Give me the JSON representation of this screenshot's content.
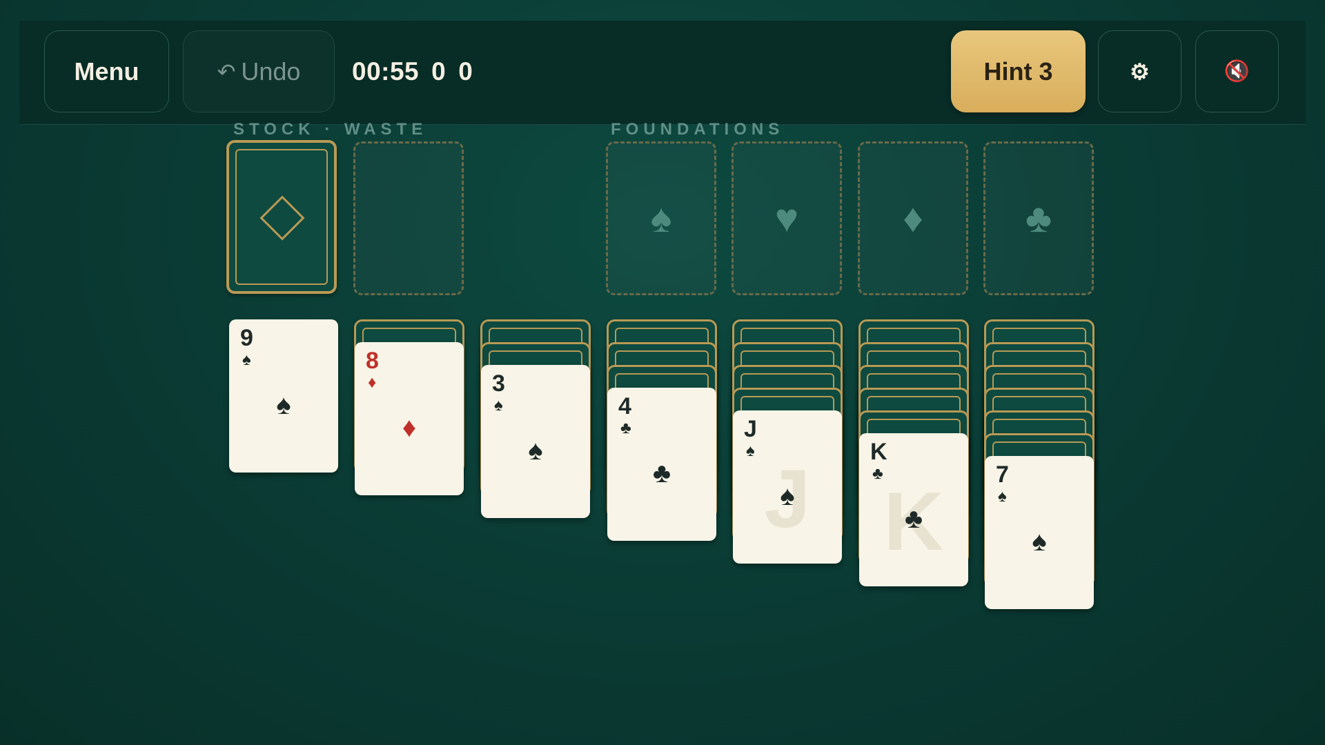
{
  "toolbar": {
    "menu_label": "Menu",
    "undo_arrow": "↶",
    "undo_label": "Undo",
    "timer": "00:55",
    "score": "0",
    "moves": "0",
    "hint_label": "Hint",
    "hint_count": "3",
    "settings_icon": "⚙",
    "sound_icon": "🔇"
  },
  "labels": {
    "stock_waste": "STOCK · WASTE",
    "foundations": "FOUNDATIONS"
  },
  "foundations": [
    {
      "suit": "spades",
      "symbol": "♠"
    },
    {
      "suit": "hearts",
      "symbol": "♥"
    },
    {
      "suit": "diamonds",
      "symbol": "♦"
    },
    {
      "suit": "clubs",
      "symbol": "♣"
    }
  ],
  "tableau": [
    {
      "face_down": 0,
      "card": {
        "rank": "9",
        "suit": "♠",
        "color": "black",
        "face": false
      }
    },
    {
      "face_down": 1,
      "card": {
        "rank": "8",
        "suit": "♦",
        "color": "red",
        "face": false
      }
    },
    {
      "face_down": 2,
      "card": {
        "rank": "3",
        "suit": "♠",
        "color": "black",
        "face": false
      }
    },
    {
      "face_down": 3,
      "card": {
        "rank": "4",
        "suit": "♣",
        "color": "black",
        "face": false
      }
    },
    {
      "face_down": 4,
      "card": {
        "rank": "J",
        "suit": "♠",
        "color": "black",
        "face": true
      }
    },
    {
      "face_down": 5,
      "card": {
        "rank": "K",
        "suit": "♣",
        "color": "black",
        "face": true
      }
    },
    {
      "face_down": 6,
      "card": {
        "rank": "7",
        "suit": "♠",
        "color": "black",
        "face": false
      }
    }
  ],
  "colors": {
    "felt": "#0a3a33",
    "gold": "#b99a55",
    "hint": "#e2bd6c",
    "card_face": "#f8f4e7",
    "red_suit": "#c0302a",
    "black_suit": "#1e2a28"
  }
}
